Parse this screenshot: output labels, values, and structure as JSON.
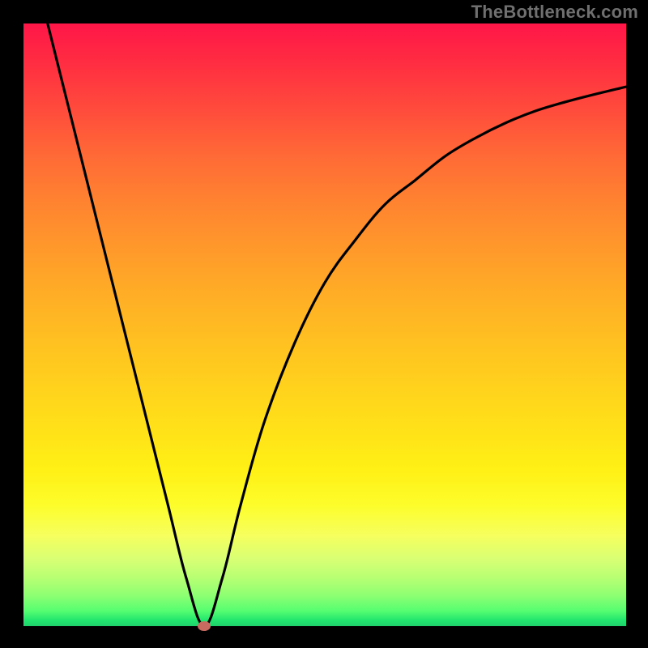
{
  "watermark": "TheBottleneck.com",
  "colors": {
    "frame": "#000000",
    "curve": "#000000",
    "marker": "#c76a60",
    "gradient_top": "#ff1648",
    "gradient_bottom": "#1fd16c"
  },
  "chart_data": {
    "type": "line",
    "title": "",
    "xlabel": "",
    "ylabel": "",
    "xlim": [
      0,
      100
    ],
    "ylim": [
      0,
      100
    ],
    "grid": false,
    "legend": false,
    "series": [
      {
        "name": "bottleneck-curve",
        "x": [
          4,
          8,
          12,
          16,
          20,
          24,
          27,
          30,
          33,
          36,
          40,
          45,
          50,
          55,
          60,
          65,
          70,
          75,
          80,
          85,
          90,
          95,
          100
        ],
        "y": [
          100,
          84,
          68,
          52,
          36,
          20,
          8,
          0,
          8,
          20,
          34,
          47,
          57,
          64,
          70,
          74,
          78,
          81,
          83.5,
          85.5,
          87,
          88.3,
          89.5
        ]
      }
    ],
    "annotations": [
      {
        "name": "minimum-marker",
        "x": 30,
        "y": 0
      }
    ]
  }
}
